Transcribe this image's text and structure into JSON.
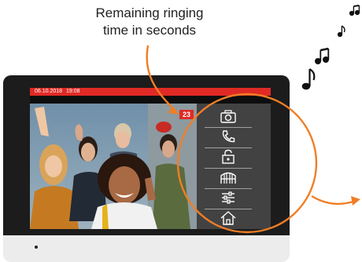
{
  "callout": {
    "line1": "Remaining ringing",
    "line2": "time in seconds"
  },
  "screen": {
    "status_bar": {
      "date": "06.10.2018",
      "time": "19:08"
    },
    "countdown": "23"
  },
  "colors": {
    "accent_orange": "#f07e26",
    "status_red": "#e02a25"
  },
  "icons": [
    "camera-icon",
    "phone-icon",
    "door-unlock-icon",
    "gate-icon",
    "settings-sliders-icon",
    "home-icon"
  ]
}
